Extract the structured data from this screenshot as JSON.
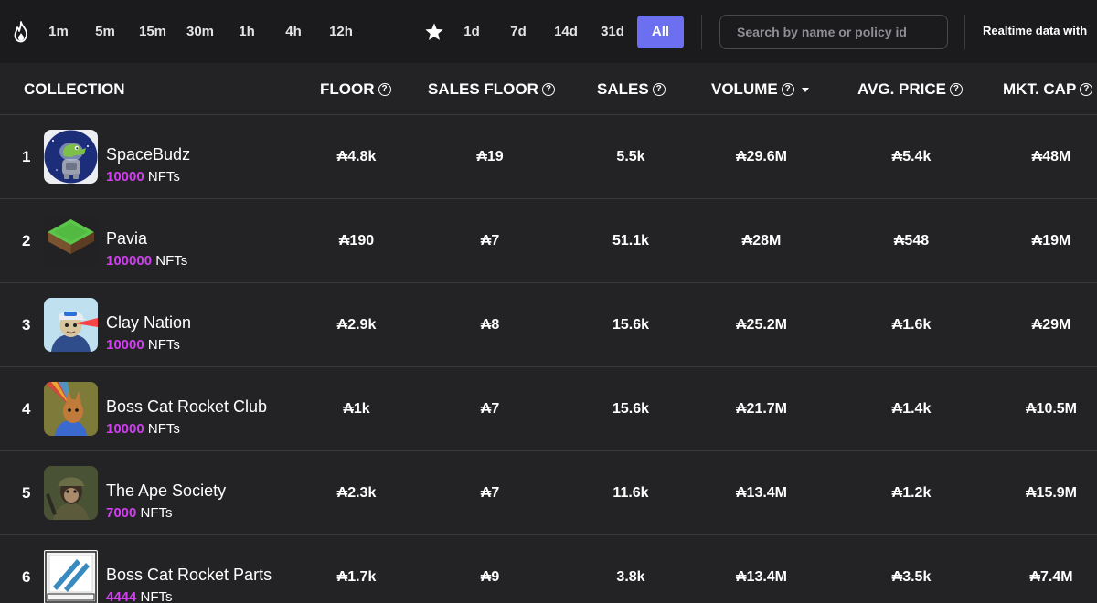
{
  "toolbar": {
    "timeframes_left": [
      "1m",
      "5m",
      "15m",
      "30m",
      "1h",
      "4h",
      "12h"
    ],
    "timeframes_right": [
      "1d",
      "7d",
      "14d",
      "31d",
      "All"
    ],
    "active_timeframe": "All",
    "search_placeholder": "Search by name or policy id",
    "realtime_label": "Realtime data with",
    "accent_color": "#6c6ff0"
  },
  "table": {
    "headers": {
      "collection": "COLLECTION",
      "floor": "FLOOR",
      "sales_floor": "SALES FLOOR",
      "sales": "SALES",
      "volume": "VOLUME",
      "avg_price": "AVG. PRICE",
      "mkt_cap": "MKT. CAP"
    },
    "rows": [
      {
        "rank": "1",
        "name": "SpaceBudz",
        "nft_count": "10000",
        "nft_suffix": " NFTs",
        "floor": "₳4.8k",
        "sales_floor": "₳19",
        "sales": "5.5k",
        "volume": "₳29.6M",
        "avg_price": "₳5.4k",
        "mkt_cap": "₳48M",
        "icon": "spacebudz-avatar"
      },
      {
        "rank": "2",
        "name": "Pavia",
        "nft_count": "100000",
        "nft_suffix": " NFTs",
        "floor": "₳190",
        "sales_floor": "₳7",
        "sales": "51.1k",
        "volume": "₳28M",
        "avg_price": "₳548",
        "mkt_cap": "₳19M",
        "icon": "pavia-land-tile"
      },
      {
        "rank": "3",
        "name": "Clay Nation",
        "nft_count": "10000",
        "nft_suffix": " NFTs",
        "floor": "₳2.9k",
        "sales_floor": "₳8",
        "sales": "15.6k",
        "volume": "₳25.2M",
        "avg_price": "₳1.6k",
        "mkt_cap": "₳29M",
        "icon": "clay-nation-avatar"
      },
      {
        "rank": "4",
        "name": "Boss Cat Rocket Club",
        "nft_count": "10000",
        "nft_suffix": " NFTs",
        "floor": "₳1k",
        "sales_floor": "₳7",
        "sales": "15.6k",
        "volume": "₳21.7M",
        "avg_price": "₳1.4k",
        "mkt_cap": "₳10.5M",
        "icon": "boss-cat-avatar"
      },
      {
        "rank": "5",
        "name": "The Ape Society",
        "nft_count": "7000",
        "nft_suffix": " NFTs",
        "floor": "₳2.3k",
        "sales_floor": "₳7",
        "sales": "11.6k",
        "volume": "₳13.4M",
        "avg_price": "₳1.2k",
        "mkt_cap": "₳15.9M",
        "icon": "ape-society-avatar"
      },
      {
        "rank": "6",
        "name": "Boss Cat Rocket Parts",
        "nft_count": "4444",
        "nft_suffix": " NFTs",
        "floor": "₳1.7k",
        "sales_floor": "₳9",
        "sales": "3.8k",
        "volume": "₳13.4M",
        "avg_price": "₳3.5k",
        "mkt_cap": "₳7.4M",
        "icon": "rocket-parts-card"
      }
    ]
  },
  "colors": {
    "background": "#232325",
    "topbar": "#1b1b1d",
    "nft_count": "#d13ff0",
    "divider": "#3a3a3d"
  }
}
